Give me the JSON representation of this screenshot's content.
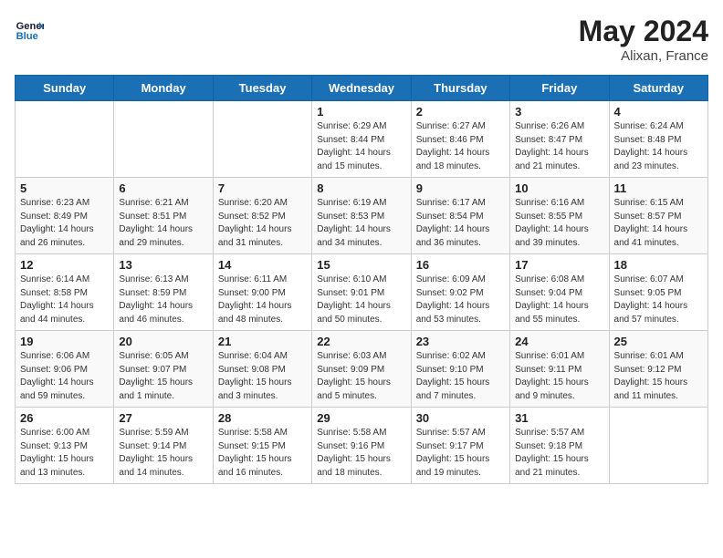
{
  "header": {
    "logo_line1": "General",
    "logo_line2": "Blue",
    "month_year": "May 2024",
    "location": "Alixan, France"
  },
  "weekdays": [
    "Sunday",
    "Monday",
    "Tuesday",
    "Wednesday",
    "Thursday",
    "Friday",
    "Saturday"
  ],
  "weeks": [
    [
      {
        "day": "",
        "sunrise": "",
        "sunset": "",
        "daylight": ""
      },
      {
        "day": "",
        "sunrise": "",
        "sunset": "",
        "daylight": ""
      },
      {
        "day": "",
        "sunrise": "",
        "sunset": "",
        "daylight": ""
      },
      {
        "day": "1",
        "sunrise": "Sunrise: 6:29 AM",
        "sunset": "Sunset: 8:44 PM",
        "daylight": "Daylight: 14 hours and 15 minutes."
      },
      {
        "day": "2",
        "sunrise": "Sunrise: 6:27 AM",
        "sunset": "Sunset: 8:46 PM",
        "daylight": "Daylight: 14 hours and 18 minutes."
      },
      {
        "day": "3",
        "sunrise": "Sunrise: 6:26 AM",
        "sunset": "Sunset: 8:47 PM",
        "daylight": "Daylight: 14 hours and 21 minutes."
      },
      {
        "day": "4",
        "sunrise": "Sunrise: 6:24 AM",
        "sunset": "Sunset: 8:48 PM",
        "daylight": "Daylight: 14 hours and 23 minutes."
      }
    ],
    [
      {
        "day": "5",
        "sunrise": "Sunrise: 6:23 AM",
        "sunset": "Sunset: 8:49 PM",
        "daylight": "Daylight: 14 hours and 26 minutes."
      },
      {
        "day": "6",
        "sunrise": "Sunrise: 6:21 AM",
        "sunset": "Sunset: 8:51 PM",
        "daylight": "Daylight: 14 hours and 29 minutes."
      },
      {
        "day": "7",
        "sunrise": "Sunrise: 6:20 AM",
        "sunset": "Sunset: 8:52 PM",
        "daylight": "Daylight: 14 hours and 31 minutes."
      },
      {
        "day": "8",
        "sunrise": "Sunrise: 6:19 AM",
        "sunset": "Sunset: 8:53 PM",
        "daylight": "Daylight: 14 hours and 34 minutes."
      },
      {
        "day": "9",
        "sunrise": "Sunrise: 6:17 AM",
        "sunset": "Sunset: 8:54 PM",
        "daylight": "Daylight: 14 hours and 36 minutes."
      },
      {
        "day": "10",
        "sunrise": "Sunrise: 6:16 AM",
        "sunset": "Sunset: 8:55 PM",
        "daylight": "Daylight: 14 hours and 39 minutes."
      },
      {
        "day": "11",
        "sunrise": "Sunrise: 6:15 AM",
        "sunset": "Sunset: 8:57 PM",
        "daylight": "Daylight: 14 hours and 41 minutes."
      }
    ],
    [
      {
        "day": "12",
        "sunrise": "Sunrise: 6:14 AM",
        "sunset": "Sunset: 8:58 PM",
        "daylight": "Daylight: 14 hours and 44 minutes."
      },
      {
        "day": "13",
        "sunrise": "Sunrise: 6:13 AM",
        "sunset": "Sunset: 8:59 PM",
        "daylight": "Daylight: 14 hours and 46 minutes."
      },
      {
        "day": "14",
        "sunrise": "Sunrise: 6:11 AM",
        "sunset": "Sunset: 9:00 PM",
        "daylight": "Daylight: 14 hours and 48 minutes."
      },
      {
        "day": "15",
        "sunrise": "Sunrise: 6:10 AM",
        "sunset": "Sunset: 9:01 PM",
        "daylight": "Daylight: 14 hours and 50 minutes."
      },
      {
        "day": "16",
        "sunrise": "Sunrise: 6:09 AM",
        "sunset": "Sunset: 9:02 PM",
        "daylight": "Daylight: 14 hours and 53 minutes."
      },
      {
        "day": "17",
        "sunrise": "Sunrise: 6:08 AM",
        "sunset": "Sunset: 9:04 PM",
        "daylight": "Daylight: 14 hours and 55 minutes."
      },
      {
        "day": "18",
        "sunrise": "Sunrise: 6:07 AM",
        "sunset": "Sunset: 9:05 PM",
        "daylight": "Daylight: 14 hours and 57 minutes."
      }
    ],
    [
      {
        "day": "19",
        "sunrise": "Sunrise: 6:06 AM",
        "sunset": "Sunset: 9:06 PM",
        "daylight": "Daylight: 14 hours and 59 minutes."
      },
      {
        "day": "20",
        "sunrise": "Sunrise: 6:05 AM",
        "sunset": "Sunset: 9:07 PM",
        "daylight": "Daylight: 15 hours and 1 minute."
      },
      {
        "day": "21",
        "sunrise": "Sunrise: 6:04 AM",
        "sunset": "Sunset: 9:08 PM",
        "daylight": "Daylight: 15 hours and 3 minutes."
      },
      {
        "day": "22",
        "sunrise": "Sunrise: 6:03 AM",
        "sunset": "Sunset: 9:09 PM",
        "daylight": "Daylight: 15 hours and 5 minutes."
      },
      {
        "day": "23",
        "sunrise": "Sunrise: 6:02 AM",
        "sunset": "Sunset: 9:10 PM",
        "daylight": "Daylight: 15 hours and 7 minutes."
      },
      {
        "day": "24",
        "sunrise": "Sunrise: 6:01 AM",
        "sunset": "Sunset: 9:11 PM",
        "daylight": "Daylight: 15 hours and 9 minutes."
      },
      {
        "day": "25",
        "sunrise": "Sunrise: 6:01 AM",
        "sunset": "Sunset: 9:12 PM",
        "daylight": "Daylight: 15 hours and 11 minutes."
      }
    ],
    [
      {
        "day": "26",
        "sunrise": "Sunrise: 6:00 AM",
        "sunset": "Sunset: 9:13 PM",
        "daylight": "Daylight: 15 hours and 13 minutes."
      },
      {
        "day": "27",
        "sunrise": "Sunrise: 5:59 AM",
        "sunset": "Sunset: 9:14 PM",
        "daylight": "Daylight: 15 hours and 14 minutes."
      },
      {
        "day": "28",
        "sunrise": "Sunrise: 5:58 AM",
        "sunset": "Sunset: 9:15 PM",
        "daylight": "Daylight: 15 hours and 16 minutes."
      },
      {
        "day": "29",
        "sunrise": "Sunrise: 5:58 AM",
        "sunset": "Sunset: 9:16 PM",
        "daylight": "Daylight: 15 hours and 18 minutes."
      },
      {
        "day": "30",
        "sunrise": "Sunrise: 5:57 AM",
        "sunset": "Sunset: 9:17 PM",
        "daylight": "Daylight: 15 hours and 19 minutes."
      },
      {
        "day": "31",
        "sunrise": "Sunrise: 5:57 AM",
        "sunset": "Sunset: 9:18 PM",
        "daylight": "Daylight: 15 hours and 21 minutes."
      },
      {
        "day": "",
        "sunrise": "",
        "sunset": "",
        "daylight": ""
      }
    ]
  ]
}
